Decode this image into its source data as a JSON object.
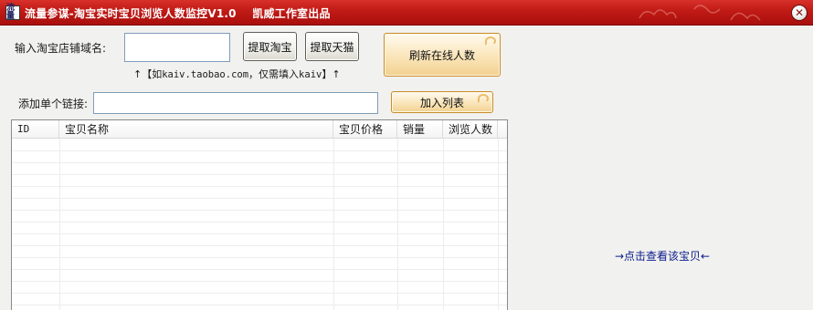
{
  "window": {
    "title": "流量参谋-淘宝实时宝贝浏览人数监控V1.0    凯威工作室出品",
    "app_icon_text": "流量",
    "close_glyph": "✕"
  },
  "shop": {
    "label": "输入淘宝店铺域名:",
    "value": "",
    "btn_taobao": "提取淘宝",
    "btn_tmall": "提取天猫",
    "hint_prefix": "↑【如",
    "hint_example": "kaiv.taobao.com",
    "hint_middle": "，仅需填入",
    "hint_key": "kaiv",
    "hint_suffix": "】↑"
  },
  "refresh_button": "刷新在线人数",
  "link": {
    "label": "添加单个链接:",
    "value": "",
    "add_button": "加入列表"
  },
  "table": {
    "columns": [
      "ID",
      "宝贝名称",
      "宝贝价格",
      "销量",
      "浏览人数"
    ],
    "rows": []
  },
  "side_link": "→点击查看该宝贝←",
  "colors": {
    "titlebar": "#c01a16",
    "button_gold": "#f3d18f",
    "link_text": "#0a1a8a"
  }
}
